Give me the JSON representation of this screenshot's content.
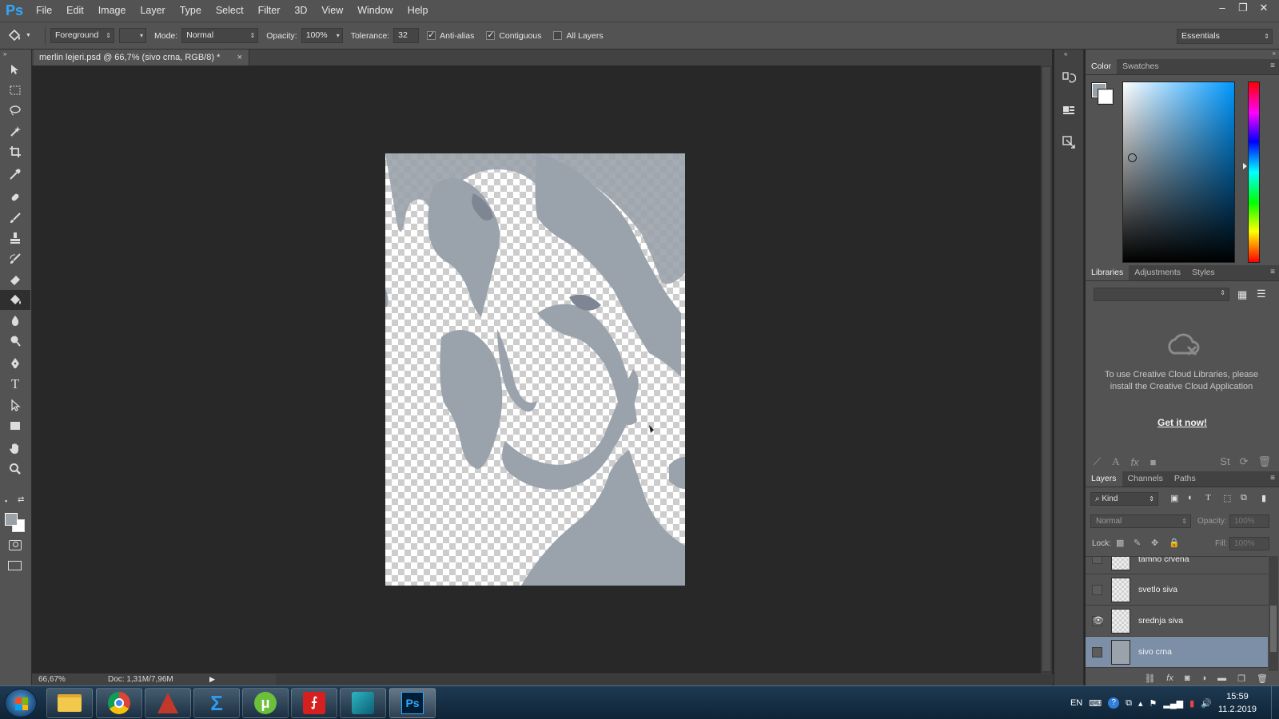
{
  "app": {
    "logo": "Ps",
    "menu": [
      "File",
      "Edit",
      "Image",
      "Layer",
      "Type",
      "Select",
      "Filter",
      "3D",
      "View",
      "Window",
      "Help"
    ],
    "window_controls": {
      "minimize": "–",
      "restore": "❐",
      "close": "✕"
    }
  },
  "options_bar": {
    "fill_source": "Foreground",
    "mode_label": "Mode:",
    "mode_value": "Normal",
    "opacity_label": "Opacity:",
    "opacity_value": "100%",
    "tolerance_label": "Tolerance:",
    "tolerance_value": "32",
    "anti_alias_label": "Anti-alias",
    "anti_alias_checked": true,
    "contiguous_label": "Contiguous",
    "contiguous_checked": true,
    "all_layers_label": "All Layers",
    "all_layers_checked": false,
    "workspace": "Essentials"
  },
  "tools": [
    "move-tool-icon",
    "marquee-tool-icon",
    "lasso-tool-icon",
    "magic-wand-icon",
    "crop-tool-icon",
    "eyedropper-icon",
    "healing-brush-icon",
    "brush-tool-icon",
    "clone-stamp-icon",
    "history-brush-icon",
    "eraser-icon",
    "paint-bucket-icon",
    "blur-tool-icon",
    "dodge-tool-icon",
    "pen-tool-icon",
    "type-tool-icon",
    "path-selection-icon",
    "rectangle-tool-icon",
    "hand-tool-icon",
    "zoom-tool-icon"
  ],
  "active_tool": "paint-bucket-icon",
  "document": {
    "tab_title": "merlin lejeri.psd @ 66,7% (sivo crna, RGB/8) *",
    "close": "×"
  },
  "status_bar": {
    "zoom": "66,67%",
    "doc_info": "Doc: 1,31M/7,96M"
  },
  "color_panel": {
    "tabs": [
      "Color",
      "Swatches"
    ],
    "active_tab": "Color",
    "foreground_color": "#9aa2a7",
    "background_color": "#ffffff",
    "hue_color": "#0098ff"
  },
  "libraries_panel": {
    "tabs": [
      "Libraries",
      "Adjustments",
      "Styles"
    ],
    "active_tab": "Libraries",
    "message": "To use Creative Cloud Libraries, please install the Creative Cloud Application",
    "link": "Get it now!"
  },
  "layers_panel": {
    "tabs": [
      "Layers",
      "Channels",
      "Paths"
    ],
    "active_tab": "Layers",
    "filter_kind": "Kind",
    "blend_mode": "Normal",
    "opacity_label": "Opacity:",
    "opacity_value": "100%",
    "lock_label": "Lock:",
    "fill_label": "Fill:",
    "fill_value": "100%",
    "layers": [
      {
        "name": "tamno crvena",
        "visible": false,
        "selected": false
      },
      {
        "name": "svetlo siva",
        "visible": false,
        "selected": false
      },
      {
        "name": "srednja siva",
        "visible": true,
        "selected": false
      },
      {
        "name": "sivo crna",
        "visible": false,
        "selected": true
      }
    ]
  },
  "taskbar": {
    "apps": [
      "file-explorer-icon",
      "chrome-icon",
      "autocad-icon",
      "sigma-app-icon",
      "utorrent-icon",
      "acrobat-icon",
      "3ds-max-icon",
      "photoshop-icon"
    ],
    "language": "EN",
    "time": "15:59",
    "date": "11.2.2019"
  }
}
